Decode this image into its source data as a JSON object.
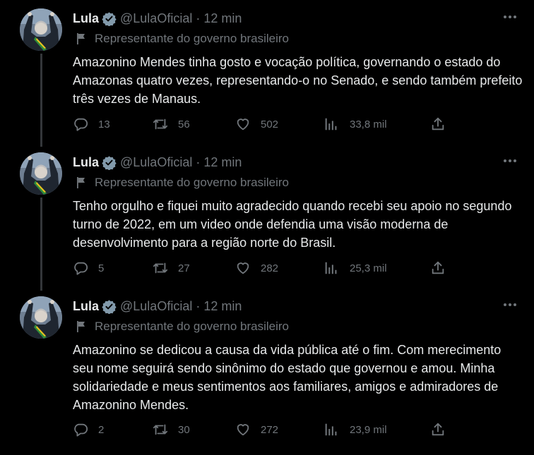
{
  "tweets": [
    {
      "name": "Lula",
      "handle": "@LulaOficial",
      "separator": "·",
      "time": "12 min",
      "label": "Representante do governo brasileiro",
      "text": "Amazonino Mendes tinha gosto e vocação política, governando o estado do Amazonas quatro vezes, representando-o no Senado, e sendo também prefeito três vezes de Manaus.",
      "replies": "13",
      "retweets": "56",
      "likes": "502",
      "views": "33,8 mil"
    },
    {
      "name": "Lula",
      "handle": "@LulaOficial",
      "separator": "·",
      "time": "12 min",
      "label": "Representante do governo brasileiro",
      "text": "Tenho orgulho e fiquei muito agradecido quando recebi seu apoio no segundo turno de 2022, em um video onde defendia uma visão moderna de desenvolvimento para a região norte do Brasil.",
      "replies": "5",
      "retweets": "27",
      "likes": "282",
      "views": "25,3 mil"
    },
    {
      "name": "Lula",
      "handle": "@LulaOficial",
      "separator": "·",
      "time": "12 min",
      "label": "Representante do governo brasileiro",
      "text": "Amazonino se dedicou a causa da vida pública até o fim. Com merecimento seu nome seguirá sendo sinônimo do estado que governou e amou. Minha solidariedade e meus sentimentos aos familiares, amigos e admiradores de Amazonino Mendes.",
      "replies": "2",
      "retweets": "30",
      "likes": "272",
      "views": "23,9 mil"
    }
  ],
  "colors": {
    "background": "#000000",
    "text": "#e7e9ea",
    "muted": "#71767b",
    "verified_badge": "#829aab",
    "thread_line": "#333639"
  },
  "icons": [
    "verified-badge-icon",
    "flag-icon",
    "more-icon",
    "reply-icon",
    "retweet-icon",
    "like-icon",
    "views-icon",
    "share-icon"
  ]
}
